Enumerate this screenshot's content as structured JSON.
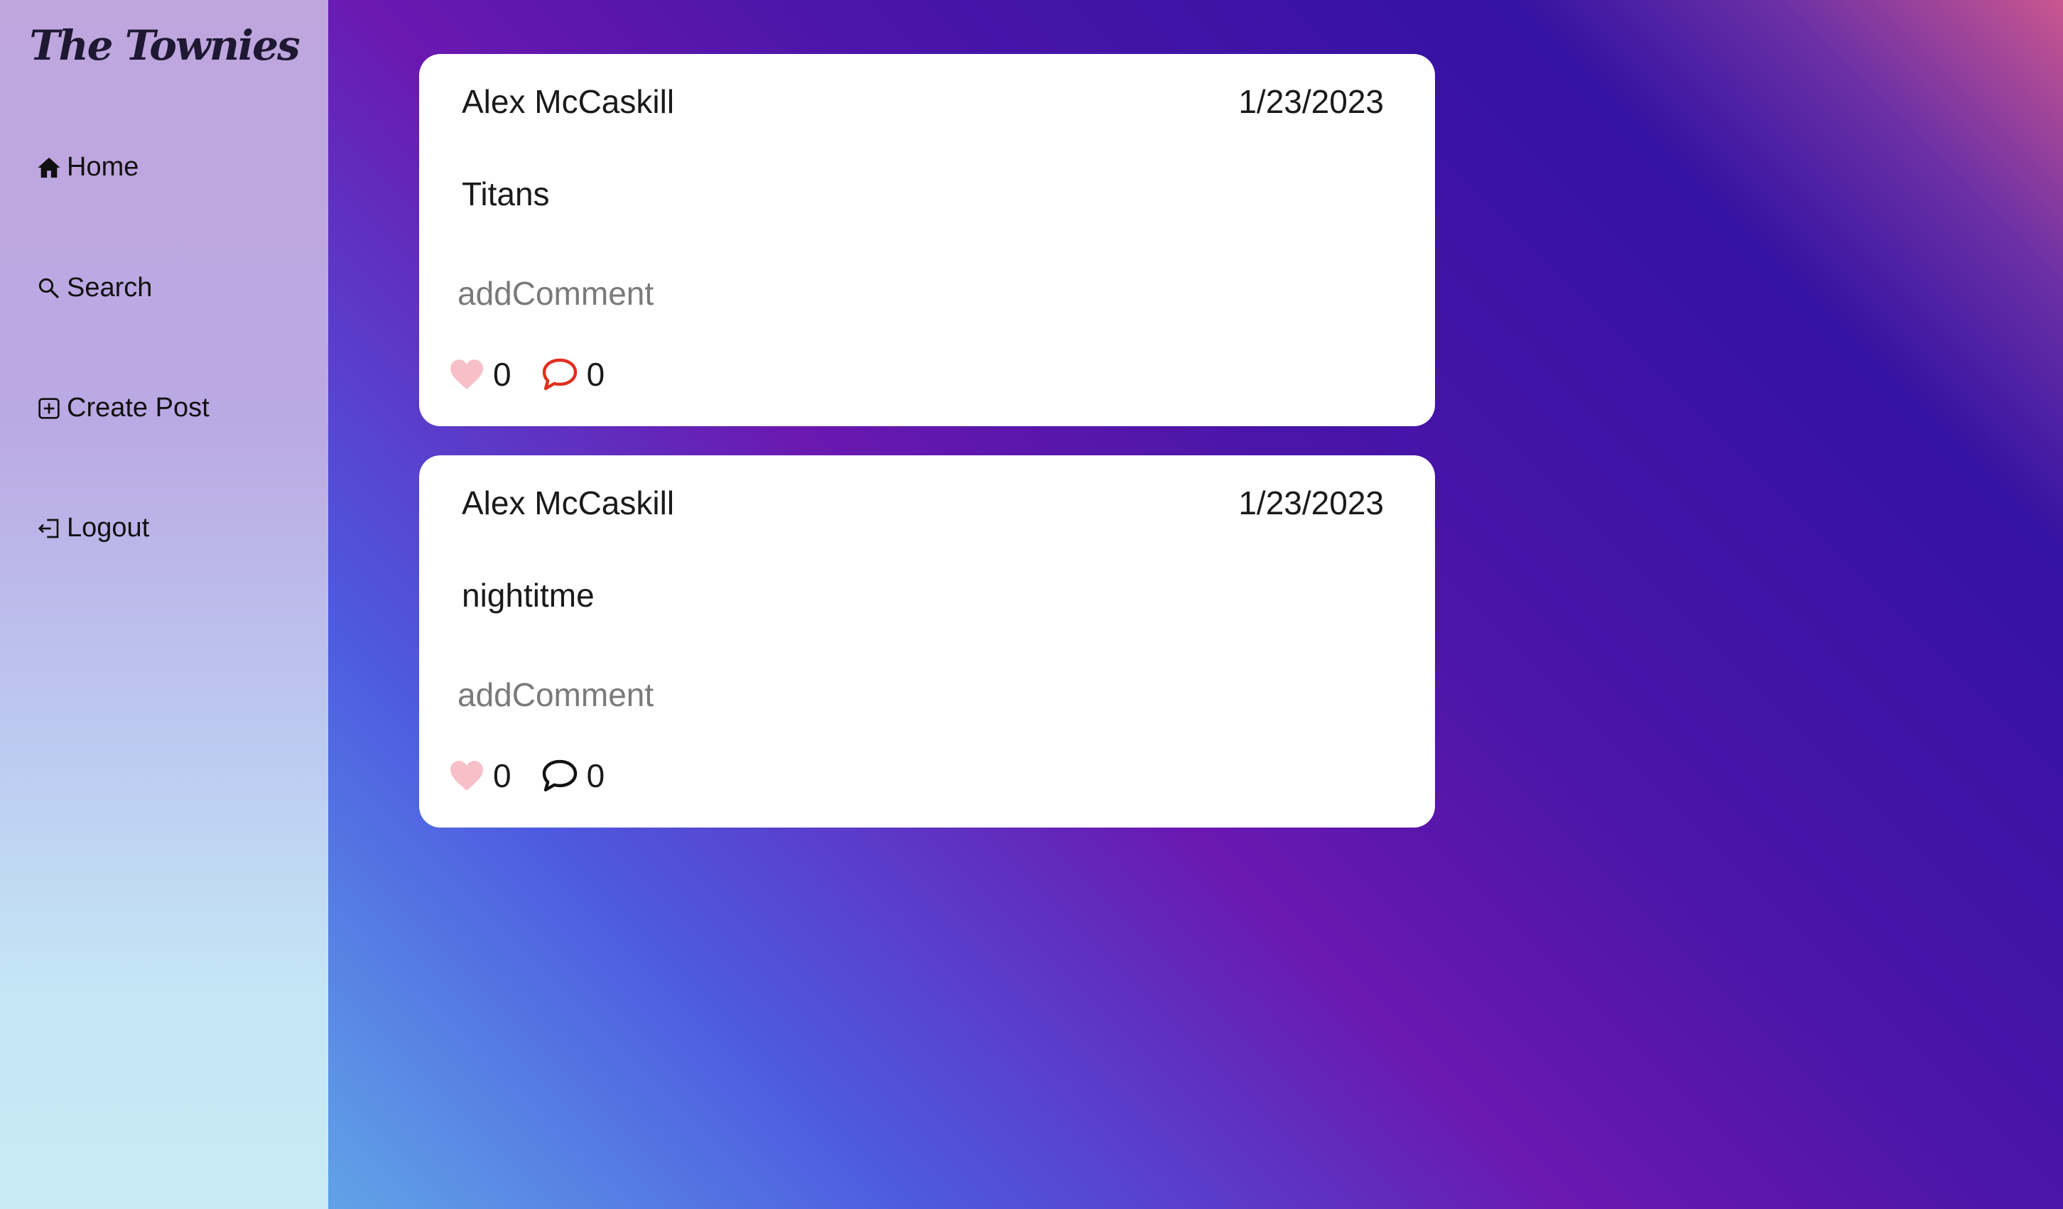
{
  "app": {
    "logo_text": "The Townies"
  },
  "sidebar": {
    "items": [
      {
        "label": "Home",
        "icon": "home-icon"
      },
      {
        "label": "Search",
        "icon": "search-icon"
      },
      {
        "label": "Create Post",
        "icon": "plus-square-icon"
      },
      {
        "label": "Logout",
        "icon": "logout-icon"
      }
    ]
  },
  "posts": [
    {
      "author": "Alex McCaskill",
      "date": "1/23/2023",
      "text": "Titans",
      "comment_placeholder": "addComment",
      "likes": "0",
      "comments": "0",
      "comment_icon_color": "#e0301e"
    },
    {
      "author": "Alex McCaskill",
      "date": "1/23/2023",
      "text": "nightitme",
      "comment_placeholder": "addComment",
      "likes": "0",
      "comments": "0",
      "comment_icon_color": "#111111"
    }
  ],
  "colors": {
    "heart": "#f7bfc8",
    "card_background": "#ffffff"
  }
}
